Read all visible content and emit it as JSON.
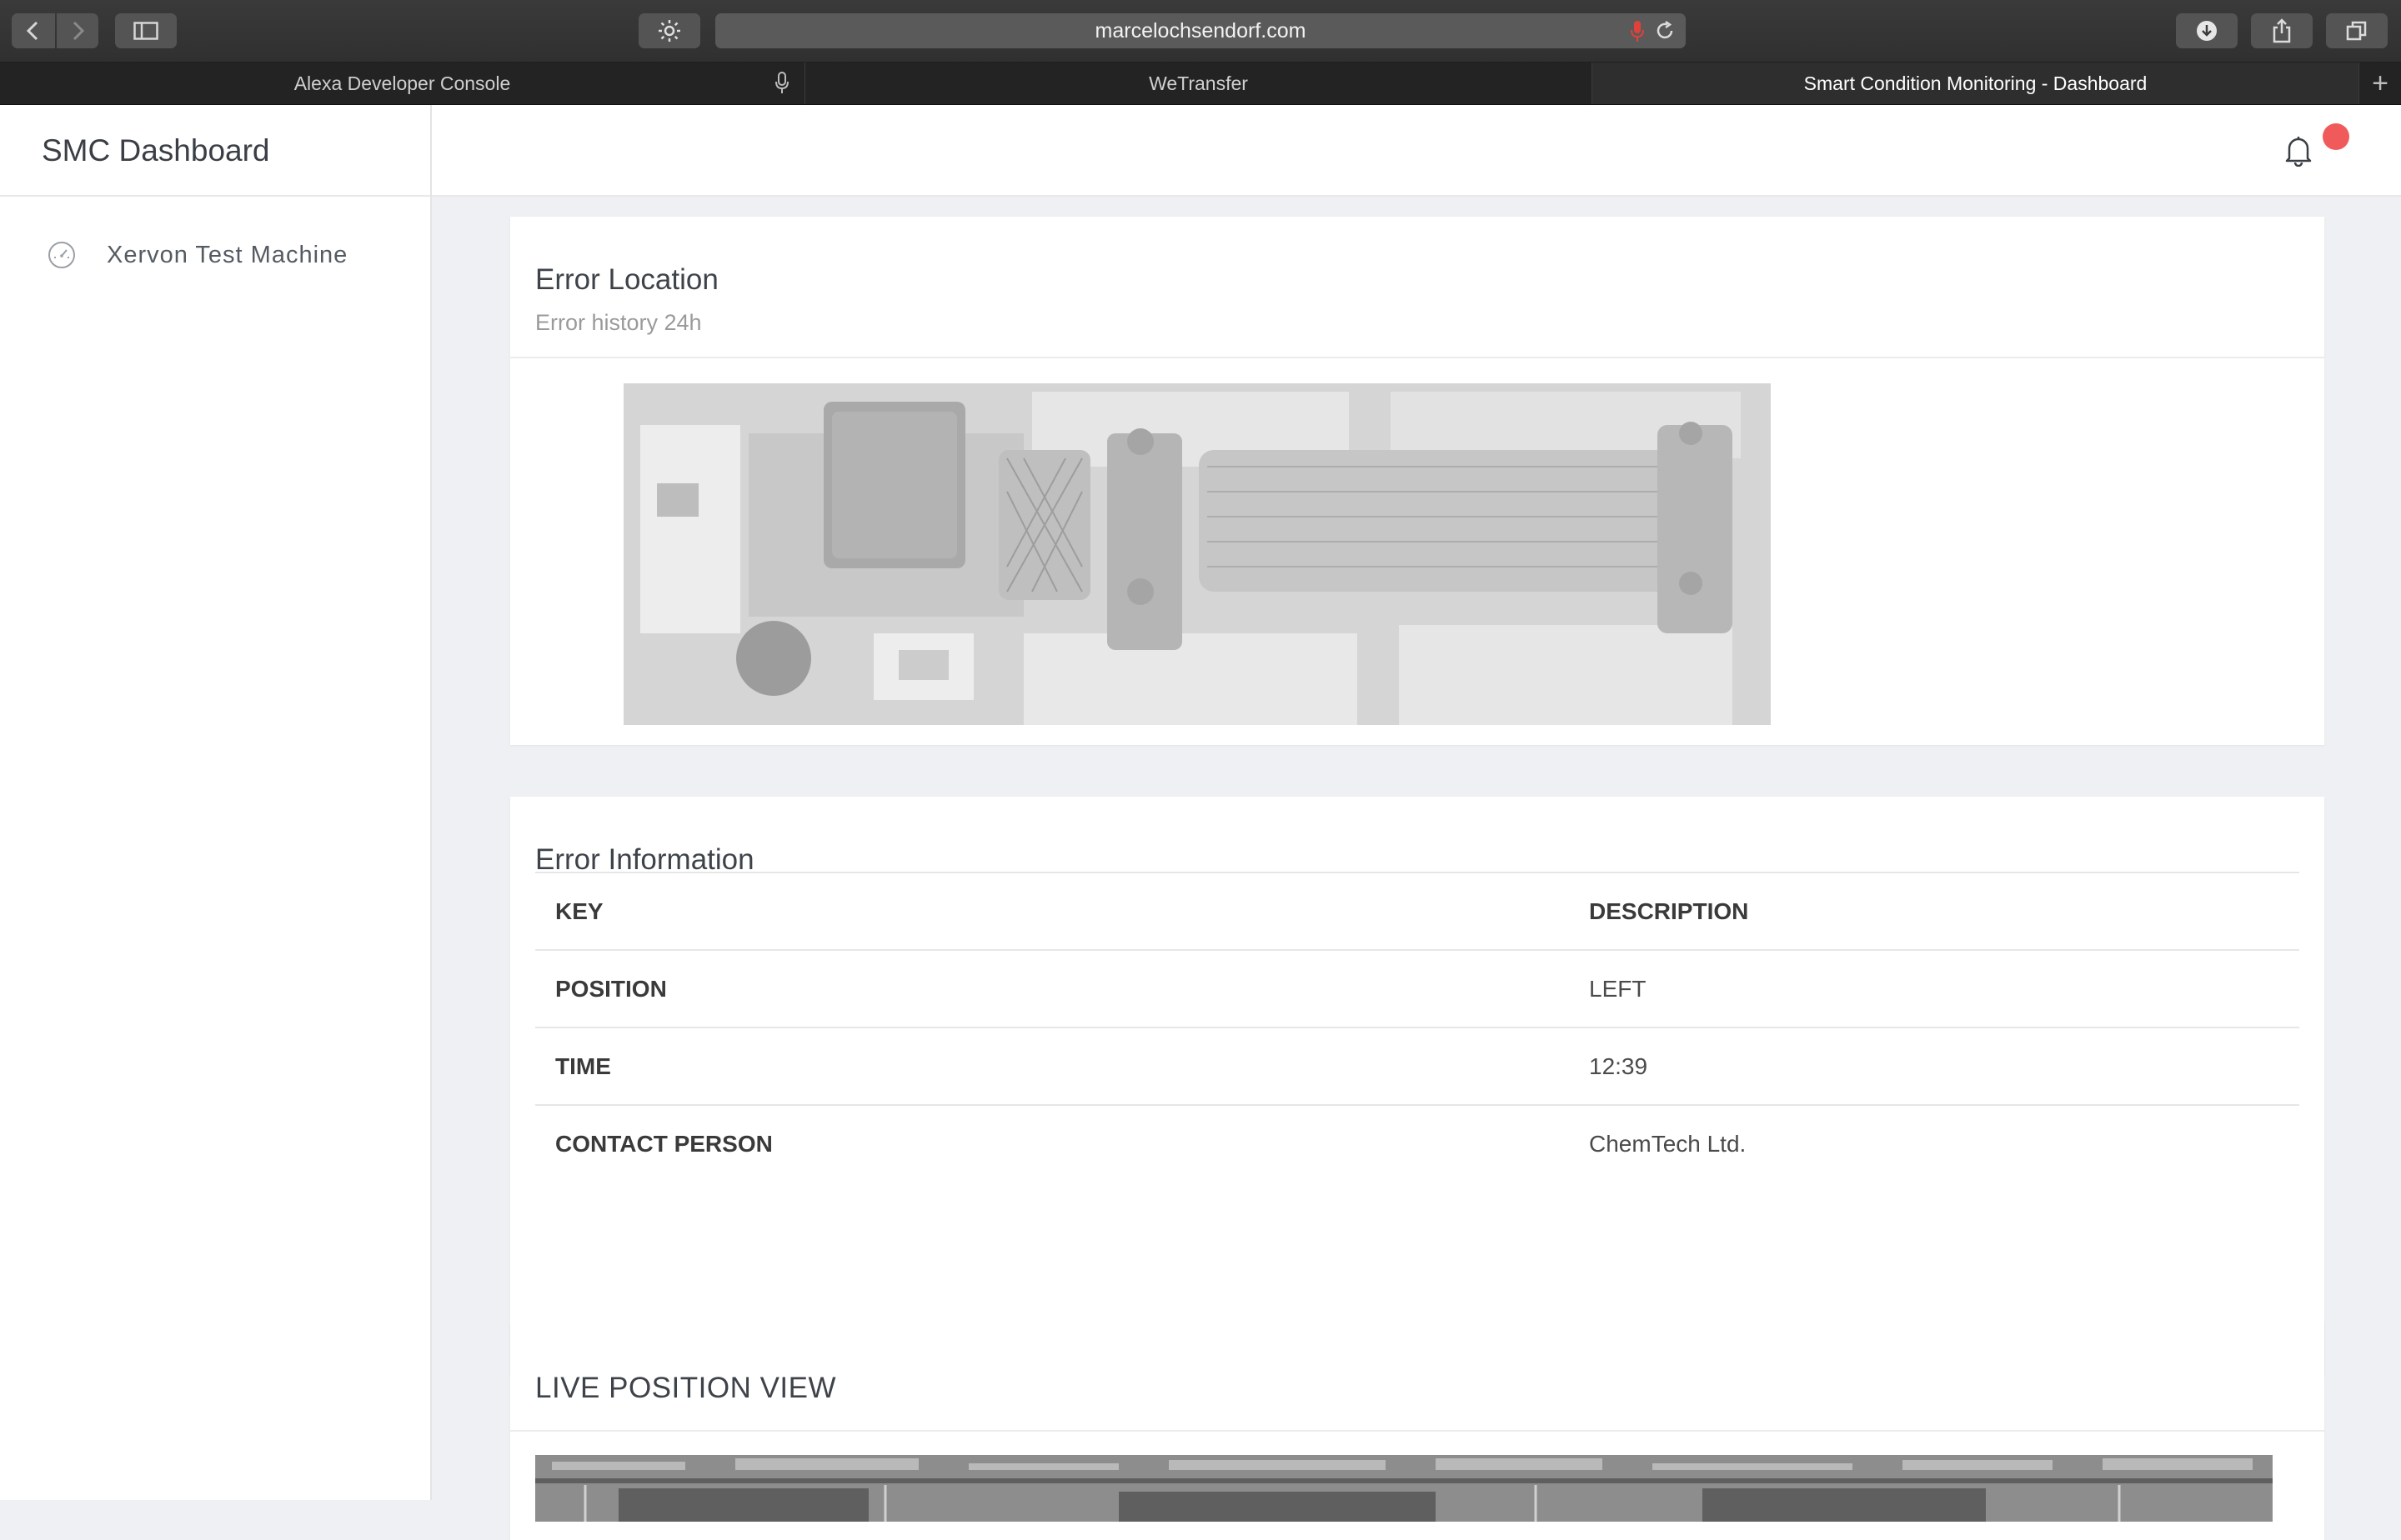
{
  "browser": {
    "url": "marcelochsendorf.com",
    "tabs": [
      {
        "label": "Alexa Developer Console"
      },
      {
        "label": "WeTransfer"
      },
      {
        "label": "Smart Condition Monitoring - Dashboard"
      }
    ],
    "new_tab_label": "+"
  },
  "header": {
    "brand": "SMC Dashboard",
    "notification_badge_color": "#f05a5a"
  },
  "sidebar": {
    "items": [
      {
        "label": "Xervon Test Machine",
        "icon": "gauge-icon"
      }
    ]
  },
  "cards": {
    "location": {
      "title": "Error Location",
      "subtitle": "Error history 24h"
    },
    "info": {
      "title": "Error Information",
      "columns": [
        "KEY",
        "DESCRIPTION"
      ],
      "rows": [
        {
          "key": "POSITION",
          "value": "LEFT"
        },
        {
          "key": "TIME",
          "value": "12:39"
        },
        {
          "key": "CONTACT PERSON",
          "value": "ChemTech Ltd."
        }
      ]
    },
    "live": {
      "title": "LIVE POSITION VIEW"
    }
  }
}
